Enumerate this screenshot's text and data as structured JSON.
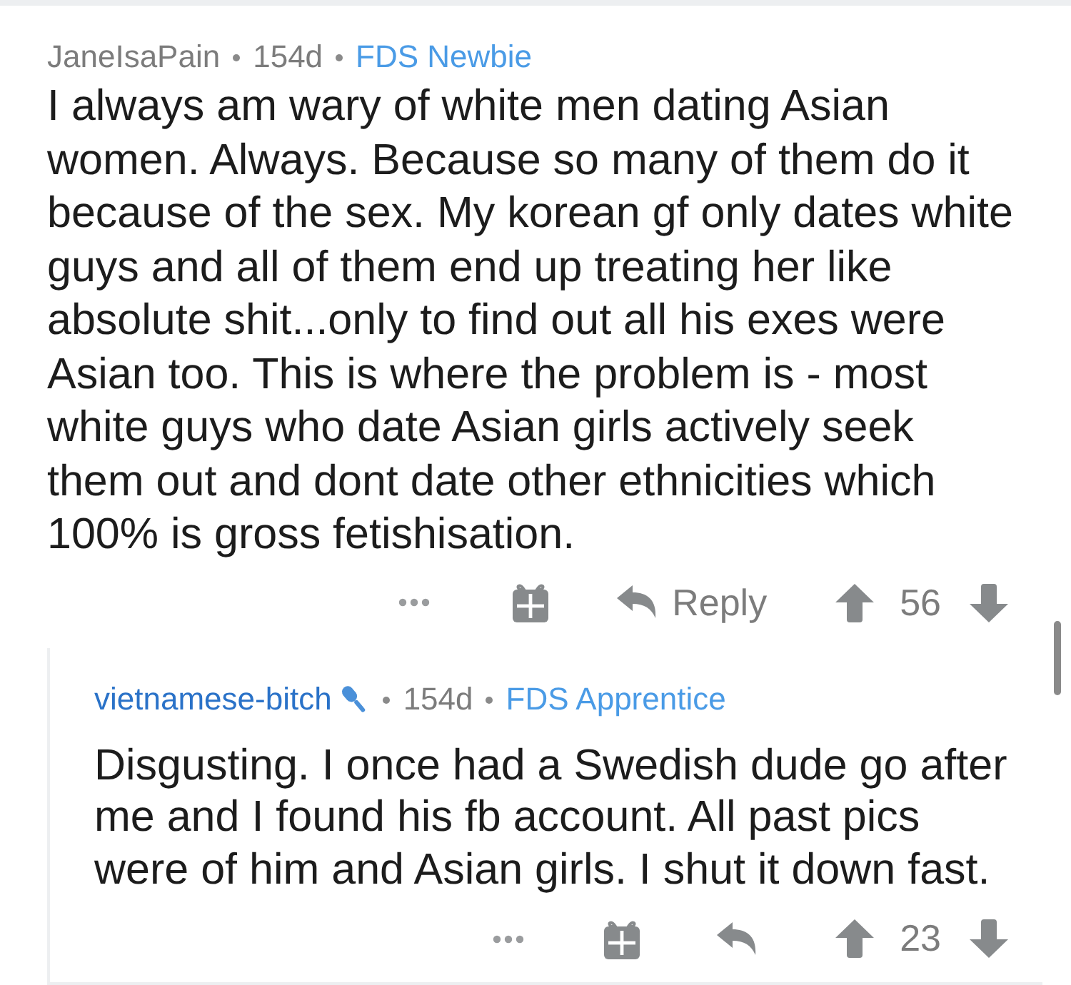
{
  "comments": [
    {
      "author": "JaneIsaPain",
      "author_highlighted": false,
      "age": "154d",
      "flair": "FDS Newbie",
      "body": "I always am wary of white men dating Asian women. Always. Because so many of them do it because of the sex. My korean gf only dates white guys and all of them end up treating her like absolute shit...only to find out all his exes were Asian too. This is where the problem is - most white guys who date Asian girls actively seek them out and dont date other ethnicities which 100% is gross fetishisation.",
      "reply_label": "Reply",
      "score": "56",
      "children": [
        {
          "author": "vietnamese-bitch",
          "author_highlighted": true,
          "author_icon": true,
          "age": "154d",
          "flair": "FDS Apprentice",
          "body": "Disgusting. I once had a Swedish dude go after me and I found his fb account. All past pics were of him and Asian girls. I shut it down fast.",
          "score": "23"
        }
      ]
    }
  ]
}
